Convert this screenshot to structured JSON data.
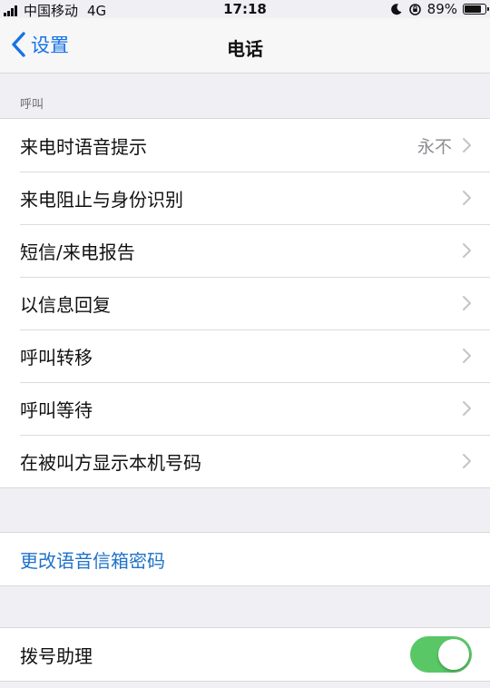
{
  "status_bar": {
    "carrier": "中国移动",
    "network": "4G",
    "time": "17:18",
    "battery": "89%",
    "battery_level": 0.89
  },
  "nav": {
    "back_label": "设置",
    "title": "电话"
  },
  "calls_section": {
    "header": "呼叫",
    "rows": [
      {
        "label": "来电时语音提示",
        "detail": "永不"
      },
      {
        "label": "来电阻止与身份识别"
      },
      {
        "label": "短信/来电报告"
      },
      {
        "label": "以信息回复"
      },
      {
        "label": "呼叫转移"
      },
      {
        "label": "呼叫等待"
      },
      {
        "label": "在被叫方显示本机号码"
      }
    ]
  },
  "voicemail": {
    "label": "更改语音信箱密码"
  },
  "dial_assist": {
    "label": "拨号助理",
    "enabled": true
  },
  "colors": {
    "accent": "#1673e6",
    "toggle_on": "#5ac766",
    "background": "#efeff4"
  }
}
